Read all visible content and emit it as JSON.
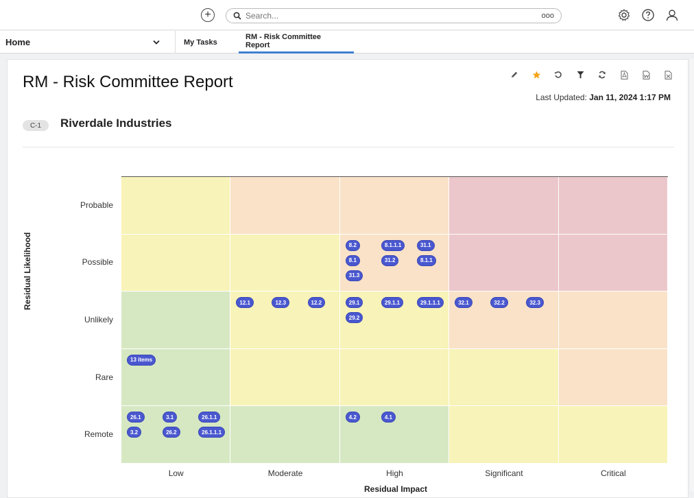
{
  "topbar": {
    "search_placeholder": "Search...",
    "search_more": "ooo"
  },
  "nav": {
    "home_label": "Home",
    "tabs": [
      {
        "label": "My Tasks"
      },
      {
        "label": "RM - Risk Committee Report"
      }
    ]
  },
  "report": {
    "title": "RM - Risk Committee Report",
    "last_updated_label": "Last Updated:",
    "last_updated_value": "Jan 11, 2024 1:17 PM",
    "org_badge": "C-1",
    "org_name": "Riverdale Industries"
  },
  "heatmap": {
    "y_axis_label": "Residual Likelihood",
    "x_axis_label": "Residual Impact",
    "rows": [
      "Probable",
      "Possible",
      "Unlikely",
      "Rare",
      "Remote"
    ],
    "columns": [
      "Low",
      "Moderate",
      "High",
      "Significant",
      "Critical"
    ],
    "colors": {
      "green": "#d6e8c2",
      "yellow": "#f8f3b8",
      "orange": "#f9e2c8",
      "red": "#ebc7cb",
      "pill": "#4a58cf"
    },
    "cell_colors": [
      [
        "yellow",
        "orange",
        "orange",
        "red",
        "red"
      ],
      [
        "yellow",
        "yellow",
        "orange",
        "red",
        "red"
      ],
      [
        "green",
        "yellow",
        "yellow",
        "orange",
        "orange"
      ],
      [
        "green",
        "yellow",
        "yellow",
        "yellow",
        "orange"
      ],
      [
        "green",
        "green",
        "green",
        "yellow",
        "yellow"
      ]
    ],
    "cells": [
      {
        "row": 1,
        "col": 2,
        "items": [
          "8.2",
          "8.1.1.1",
          "31.1",
          "8.1",
          "31.2",
          "8.1.1",
          "31.3"
        ]
      },
      {
        "row": 2,
        "col": 1,
        "items": [
          "12.1",
          "12.3",
          "12.2"
        ]
      },
      {
        "row": 2,
        "col": 2,
        "items": [
          "29.1",
          "29.1.1",
          "29.1.1.1",
          "29.2"
        ]
      },
      {
        "row": 2,
        "col": 3,
        "items": [
          "32.1",
          "32.2",
          "32.3"
        ]
      },
      {
        "row": 3,
        "col": 0,
        "items": [
          "13 items"
        ]
      },
      {
        "row": 4,
        "col": 0,
        "items": [
          "26.1",
          "3.1",
          "26.1.1",
          "3.2",
          "26.2",
          "26.1.1.1"
        ]
      },
      {
        "row": 4,
        "col": 2,
        "items": [
          "4.2",
          "4.1"
        ]
      }
    ]
  }
}
